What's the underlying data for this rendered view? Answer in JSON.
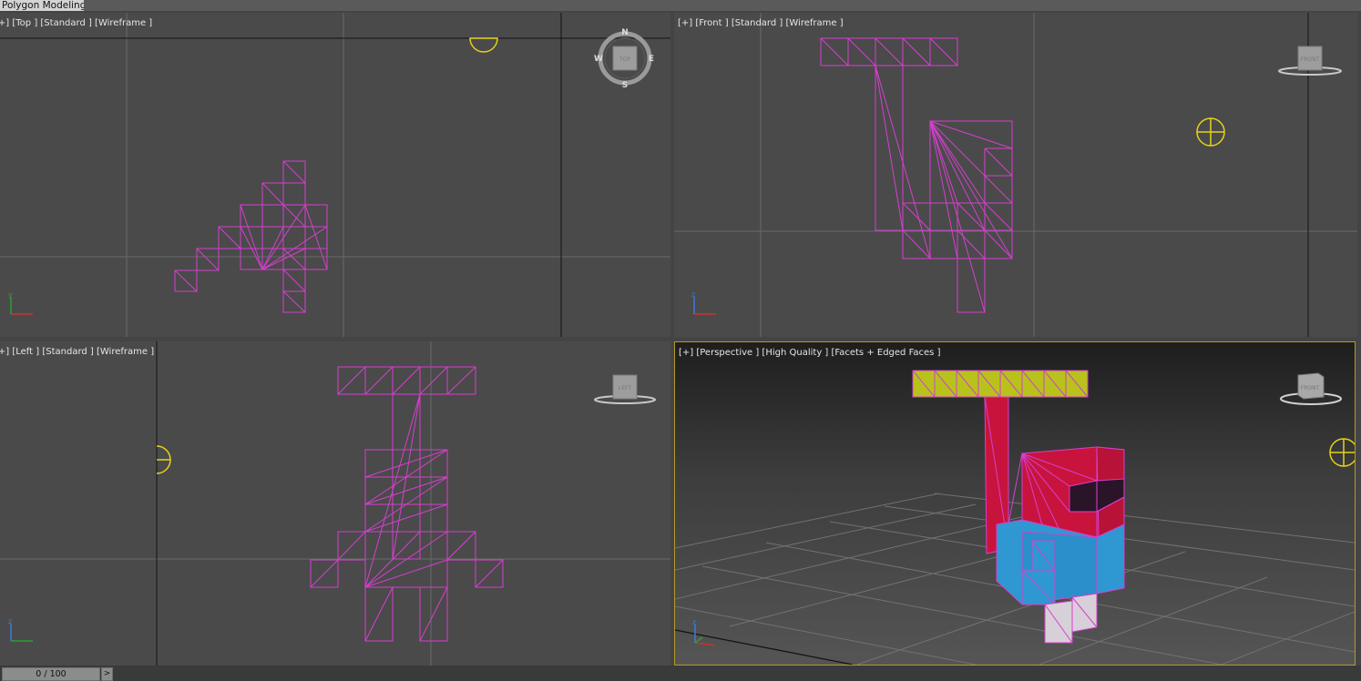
{
  "ribbon": {
    "active_tab": "Polygon Modeling"
  },
  "viewports": {
    "top": {
      "label": "[+] [Top ] [Standard ] [Wireframe ]"
    },
    "front": {
      "label": "[+] [Front ] [Standard ] [Wireframe ]"
    },
    "left": {
      "label": "[+] [Left ] [Standard ] [Wireframe ]"
    },
    "perspective": {
      "label": "[+] [Perspective ] [High Quality ] [Facets + Edged Faces ]"
    }
  },
  "compass": {
    "north": "N",
    "south": "S",
    "east": "E",
    "west": "W"
  },
  "viewcube": {
    "top": "TOP",
    "front": "FRONT",
    "left": "LEFT",
    "persp": "FRONT"
  },
  "axis": {
    "x": "x",
    "y": "y",
    "z": "z"
  },
  "timeline": {
    "frame_readout": "0 / 100",
    "next_button": ">"
  },
  "colors": {
    "wire": "#d53fd0",
    "grid": "#6a6a6a",
    "axis_line": "#111111",
    "light_gizmo": "#e6d21a",
    "active_border": "#b49a2a",
    "yellow_block": "#b9c21c",
    "red_block": "#c8143c",
    "blue_block": "#2f97d2",
    "white_block": "#d8d0d8",
    "dark_face": "#2a1428"
  }
}
